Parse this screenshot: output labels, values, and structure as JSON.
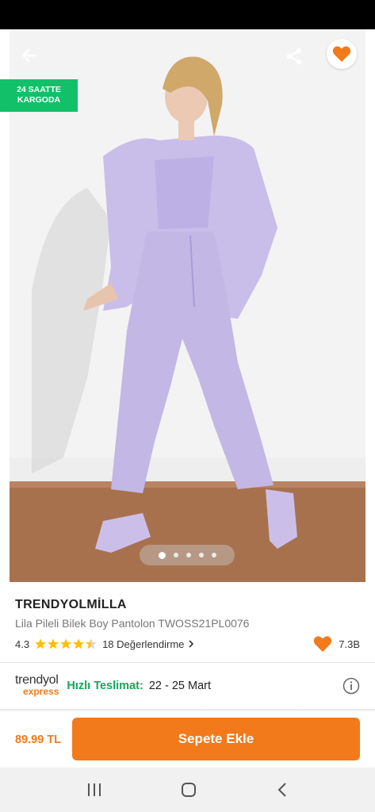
{
  "badge": {
    "line1": "24 SAATTE",
    "line2": "KARGODA"
  },
  "product": {
    "brand": "TRENDYOLMİLLA",
    "name": "Lila Pileli Bilek Boy Pantolon TWOSS21PL0076",
    "rating": "4.3",
    "rating_value": 4.3,
    "reviews": "18 Değerlendirme",
    "favorites": "7.3B"
  },
  "gallery": {
    "total": 5,
    "active": 1
  },
  "delivery": {
    "logo_top": "trendyol",
    "logo_bottom": "express",
    "label": "Hızlı Teslimat:",
    "dates": "22 - 25 Mart"
  },
  "buy": {
    "price": "89.99 TL",
    "button": "Sepete Ekle"
  },
  "colors": {
    "accent": "#f27a1a",
    "green": "#12c06a",
    "lilac": "#c8bde9"
  },
  "icons": [
    "back-arrow-icon",
    "share-icon",
    "heart-icon",
    "star-icon",
    "chevron-right-icon",
    "info-icon",
    "recent-apps-icon",
    "home-icon",
    "back-icon"
  ]
}
